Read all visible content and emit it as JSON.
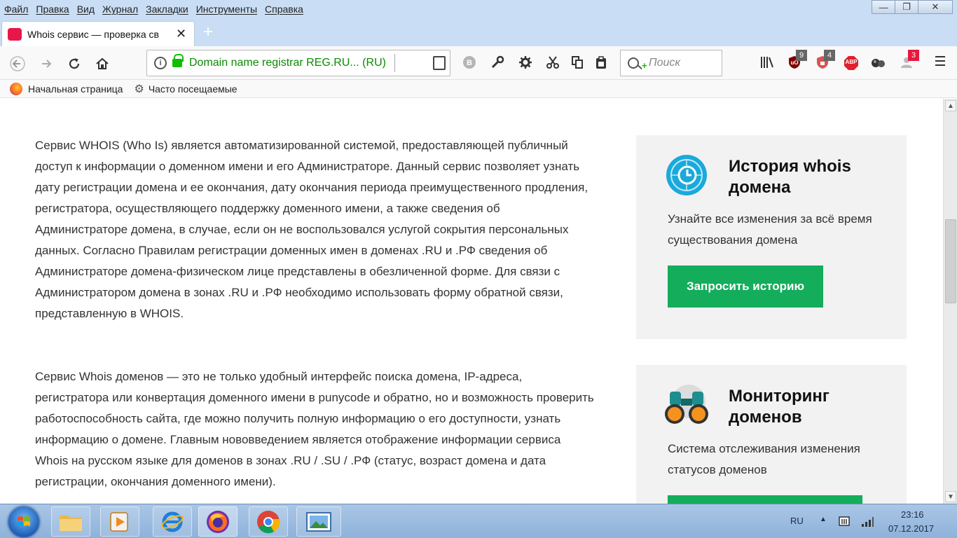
{
  "menu": [
    "Файл",
    "Правка",
    "Вид",
    "Журнал",
    "Закладки",
    "Инструменты",
    "Справка"
  ],
  "window_buttons": {
    "minimize": "—",
    "restore": "❐",
    "close": "✕"
  },
  "tab": {
    "title": "Whois сервис — проверка св",
    "close": "✕",
    "new_tab": "+"
  },
  "nav": {
    "url": "Domain name registrar REG.RU... (RU)",
    "search_placeholder": "Поиск"
  },
  "extensions": [
    {
      "name": "ublock-icon",
      "badge": "9",
      "color": "#800000"
    },
    {
      "name": "shield-icon",
      "badge": "4",
      "color": "#d9534f"
    },
    {
      "name": "adblock-icon",
      "label": "ABP",
      "color": "#e0202a"
    },
    {
      "name": "ghostery-icon",
      "color": "#333333"
    },
    {
      "name": "notification-icon",
      "badge": "3",
      "color": "#e8173d"
    }
  ],
  "bookmarks": {
    "home": "Начальная страница",
    "frequent": "Часто посещаемые"
  },
  "content": {
    "paragraph1": "Сервис WHOIS (Who Is) является автоматизированной системой, предоставляющей публичный доступ к информации о доменном имени и его Администраторе. Данный сервис позволяет узнать дату регистрации домена и ее окончания, дату окончания периода преимущественного продления, регистратора, осуществляющего поддержку доменного имени, а также сведения об Администраторе домена, в случае, если он не воспользовался услугой сокрытия персональных данных. Согласно Правилам регистрации доменных имен в доменах .RU и .РФ сведения об Администраторе домена-физическом лице представлены в обезличенной форме. Для связи с Администратором домена в зонах .RU и .РФ необходимо использовать форму обратной связи, представленную в WHOIS.",
    "paragraph2": "Сервис Whois доменов — это не только удобный интерфейс поиска домена, IP-адреса, регистратора или конвертация доменного имени в punycode и обратно, но и возможность проверить работоспособность сайта, где можно получить полную информацию о его доступности, узнать информацию о домене. Главным нововведением является отображение информации сервиса Whois на русском языке для доменов в зонах .RU / .SU / .РФ (статус, возраст домена и дата регистрации, окончания доменного имени)."
  },
  "cards": [
    {
      "title": "История whois домена",
      "description": "Узнайте все изменения за всё время существования домена",
      "button": "Запросить историю"
    },
    {
      "title": "Мониторинг доменов",
      "description": "Система отслеживания изменения статусов доменов"
    }
  ],
  "tray": {
    "lang": "RU",
    "time": "23:16",
    "date": "07.12.2017"
  },
  "colors": {
    "accent_green": "#14ad5b",
    "url_green": "#0a8b00",
    "taskbar": "#a9c6e6"
  }
}
